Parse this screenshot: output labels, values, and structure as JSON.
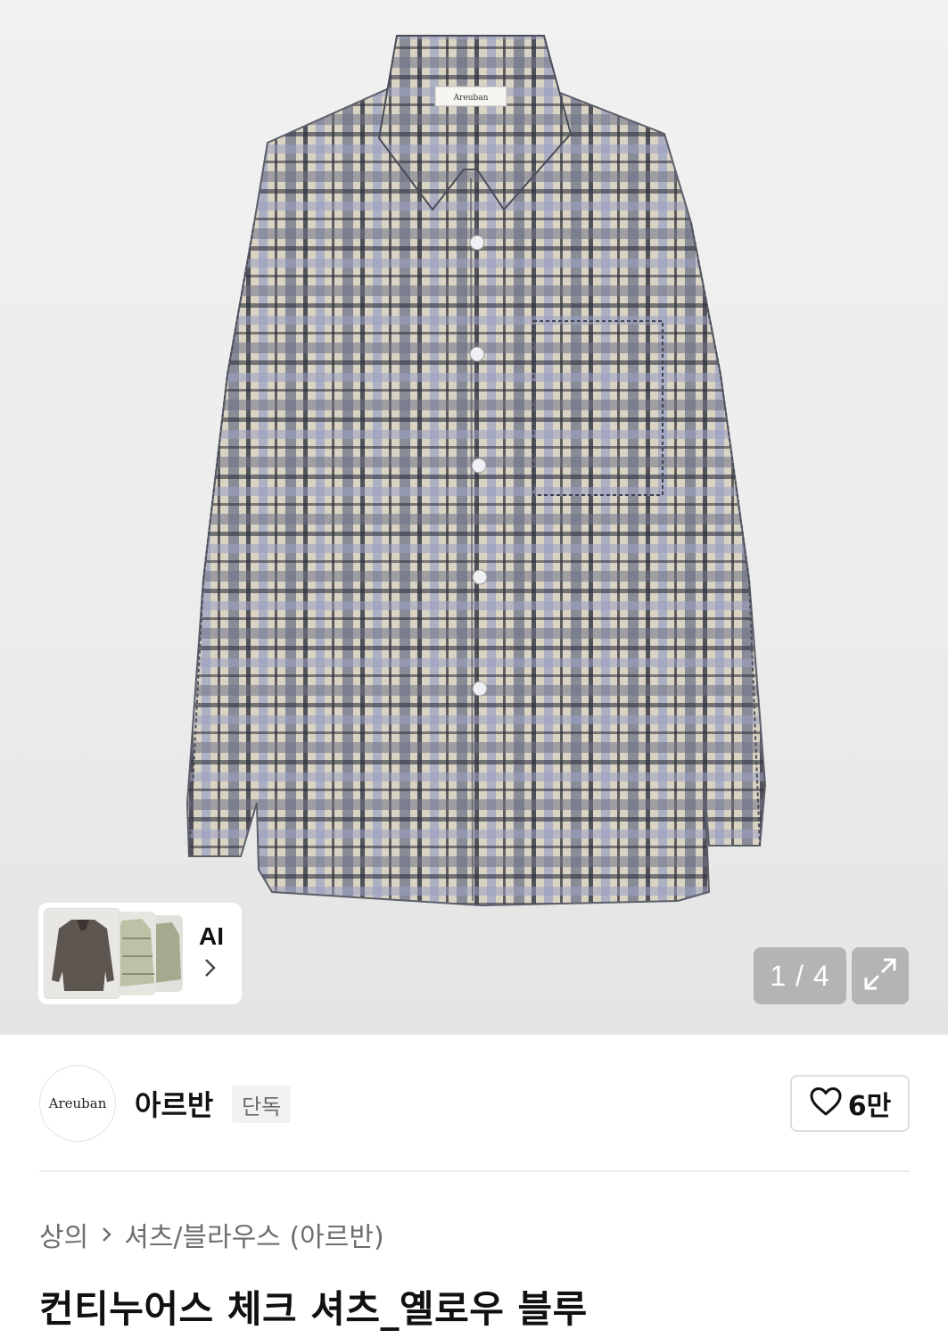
{
  "hero": {
    "image_alt_icon": "product-shirt-photo",
    "collar_label": "Areuban"
  },
  "gallery": {
    "ai_label": "AI",
    "counter": "1 / 4",
    "current_page": 1,
    "total_pages": 4
  },
  "brand": {
    "logo_text": "Areuban",
    "name": "아르반",
    "badge": "단독"
  },
  "like": {
    "count": "6만"
  },
  "breadcrumb": {
    "items": [
      "상의",
      "셔츠/블라우스 (아르반)"
    ]
  },
  "product": {
    "title": "컨티누어스 체크 셔츠_옐로우 블루"
  },
  "colors": {
    "accent": "#111111",
    "muted_text": "#6e6e6e",
    "hero_bg": "#ececec"
  }
}
